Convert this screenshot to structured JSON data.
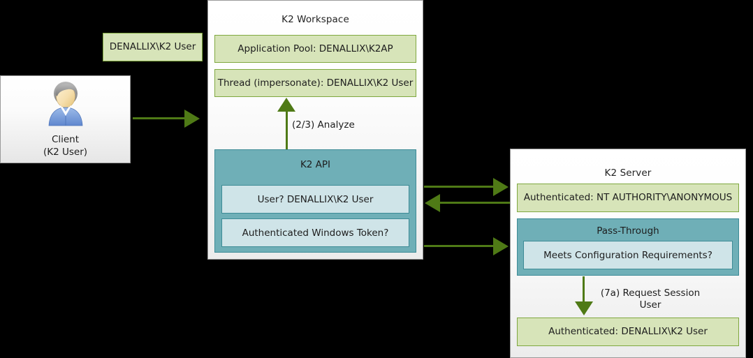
{
  "diagram": {
    "background": "#000000",
    "accent_green": "#4f7a16",
    "box_green_fill": "#d7e4b9",
    "box_green_border": "#7fa83f",
    "box_teal_fill": "#6fafb7",
    "box_teal_inner_fill": "#cfe4e8",
    "box_teal_border": "#3d8b96"
  },
  "client": {
    "icon": "user-avatar-icon",
    "label_line1": "Client",
    "label_line2": "(K2 User)"
  },
  "credential_tag": {
    "label": "DENALLIX\\K2 User"
  },
  "workspace": {
    "title": "K2 Workspace",
    "app_pool": "Application Pool: DENALLIX\\K2AP",
    "thread": "Thread (impersonate): DENALLIX\\K2 User",
    "api": {
      "title": "K2 API",
      "items": [
        "User? DENALLIX\\K2 User",
        "Authenticated Windows Token?"
      ]
    }
  },
  "server": {
    "title": "K2 Server",
    "authenticated_anonymous": "Authenticated: NT AUTHORITY\\ANONYMOUS",
    "pass_through": {
      "title": "Pass-Through",
      "item": "Meets Configuration Requirements?"
    },
    "authenticated_user": "Authenticated: DENALLIX\\K2 User"
  },
  "edges": {
    "client_to_workspace": "",
    "analyze": "(2/3) Analyze",
    "request_session_user": "(7a) Request Session\nUser"
  }
}
